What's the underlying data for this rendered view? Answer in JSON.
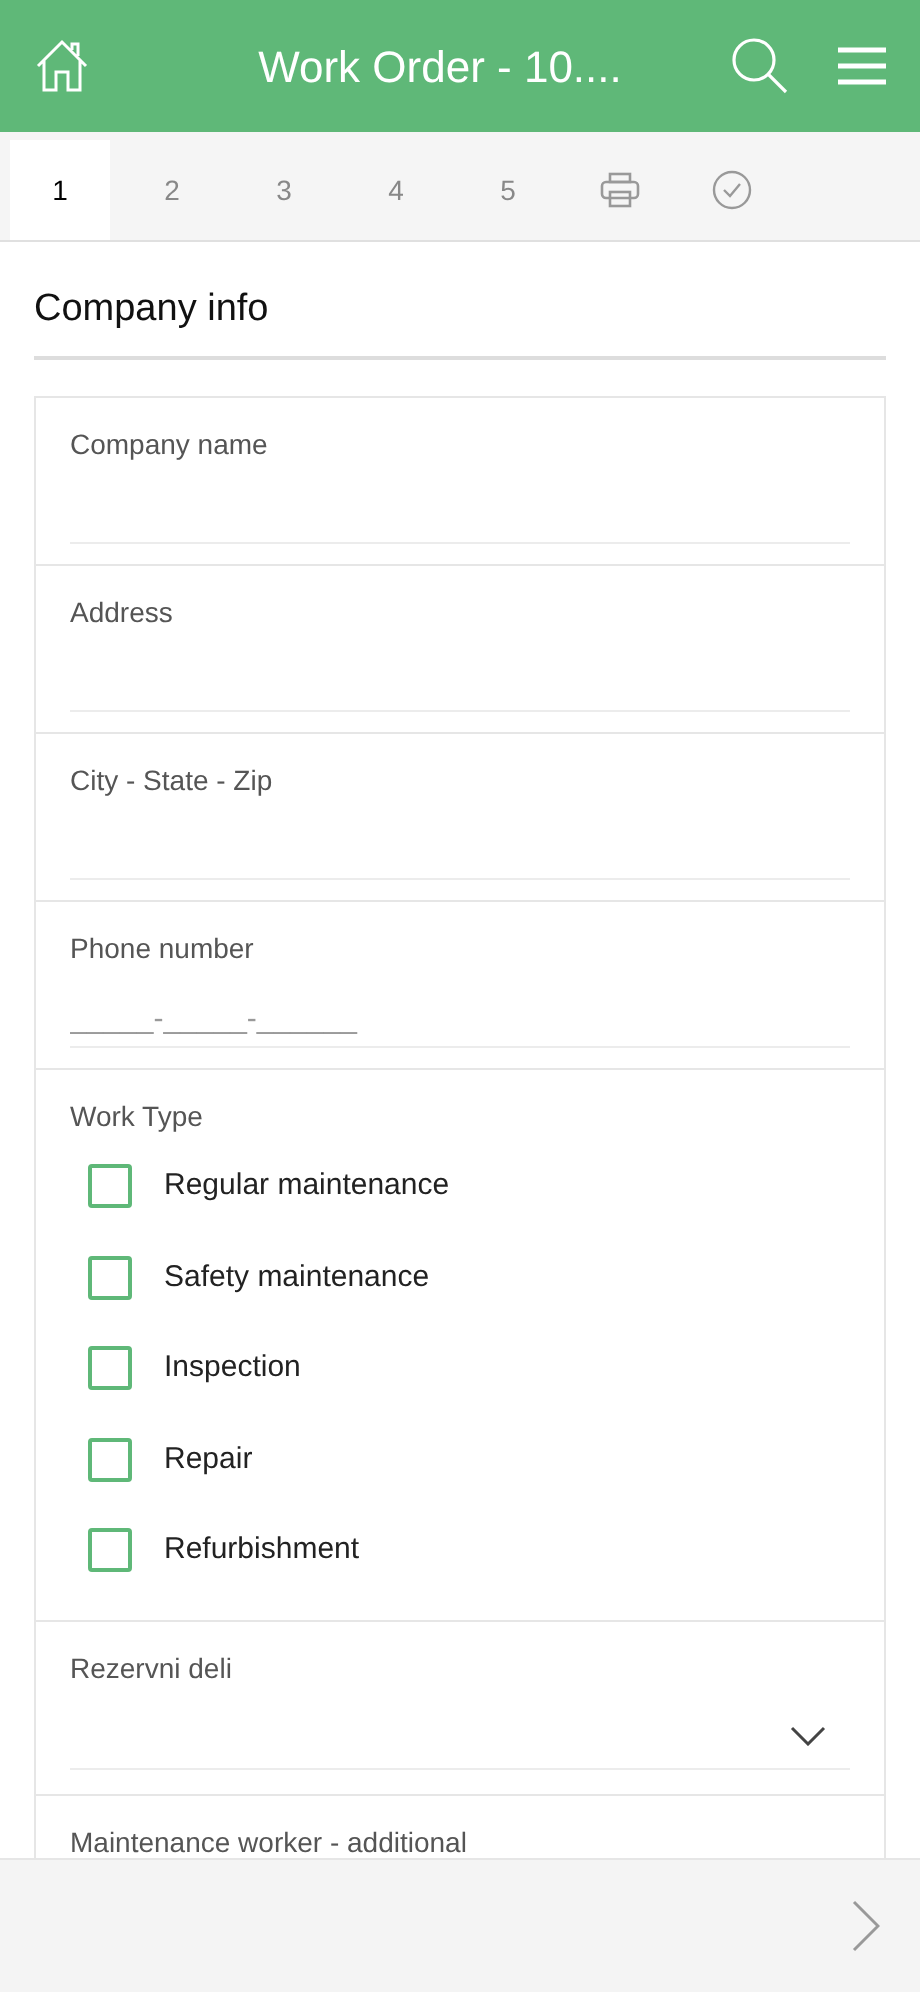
{
  "header": {
    "title": "Work Order - 10...."
  },
  "tabs": [
    {
      "kind": "number",
      "label": "1",
      "selected": true
    },
    {
      "kind": "number",
      "label": "2",
      "selected": false
    },
    {
      "kind": "number",
      "label": "3",
      "selected": false
    },
    {
      "kind": "number",
      "label": "4",
      "selected": false
    },
    {
      "kind": "number",
      "label": "5",
      "selected": false
    },
    {
      "kind": "print",
      "selected": false
    },
    {
      "kind": "check",
      "selected": false
    }
  ],
  "section": {
    "title": "Company info"
  },
  "fields": [
    {
      "kind": "text",
      "label": "Company name"
    },
    {
      "kind": "text",
      "label": "Address"
    },
    {
      "kind": "text",
      "label": "City - State - Zip"
    },
    {
      "kind": "text",
      "label": "Phone number",
      "placeholder": "_____-_____-______"
    },
    {
      "kind": "checkboxes",
      "label": "Work Type",
      "options": [
        {
          "label": "Regular maintenance",
          "checked": false
        },
        {
          "label": "Safety maintenance",
          "checked": false
        },
        {
          "label": "Inspection",
          "checked": false
        },
        {
          "label": "Repair",
          "checked": false
        },
        {
          "label": "Refurbishment",
          "checked": false
        }
      ]
    },
    {
      "kind": "select",
      "label": "Rezervni deli"
    },
    {
      "kind": "label_only",
      "label": "Maintenance worker - additional"
    }
  ]
}
